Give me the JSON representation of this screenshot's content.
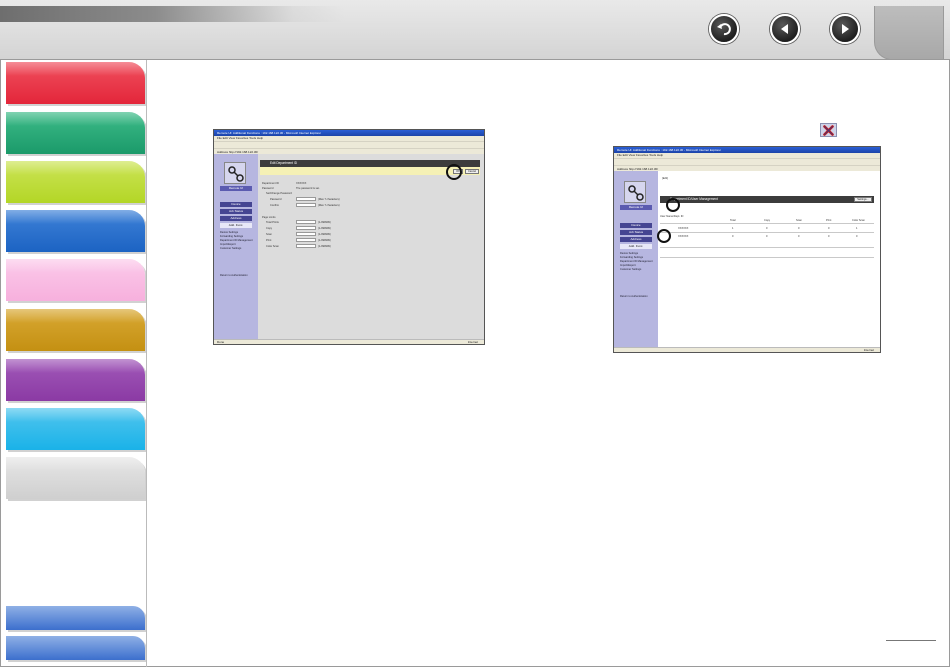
{
  "colors": {
    "tab_red": "#e3263a",
    "tab_green": "#1b9a6a",
    "tab_lime": "#b3d626",
    "tab_blue": "#1c63c3",
    "tab_pink": "#f7b0dd",
    "tab_gold": "#c49012",
    "tab_purple": "#8b3aa4",
    "tab_cyan": "#1ab2e8",
    "tab_gray": "#d4d4d4"
  },
  "header": {
    "icons": [
      "back-icon",
      "previous-page-icon",
      "next-page-icon"
    ]
  },
  "left_shot": {
    "window_title": "Remote UI: Additional Functions : 192.168.122.30 - Microsoft Internet Explorer",
    "menu": "File  Edit  View  Favorites  Tools  Help",
    "address": "Address  http://192.168.122.30/",
    "pane_title": "Edit Department ID",
    "ok_label": "OK",
    "cancel_label": "Cancel",
    "sidebar": {
      "logo_caption": "Remote UI",
      "pills": [
        "Device",
        "Job Status",
        "Address",
        "Add. Func."
      ],
      "links": [
        "Device Settings",
        "Forwarding Settings",
        "Department ID Management",
        "Import/Export",
        "Customer Settings"
      ],
      "bottom_link": "Return to Authentication"
    },
    "fields": {
      "department_id_label": "Department ID",
      "department_id_value": "XXXXXX",
      "password_label": "Password",
      "password_value": "The password is set.",
      "change_password_label": "Set/Change Password",
      "new_password_label": "Password",
      "confirm_label": "Confirm",
      "max_chars": "(Max 7 characters)",
      "page_limits_label": "Page Limits",
      "limits": [
        "Total Prints",
        "Copy",
        "Scan",
        "Print",
        "Color Scan"
      ],
      "limit_range": "(1-999999)"
    },
    "status": "Done",
    "status_zone": "Internet"
  },
  "right_shot": {
    "window_title": "Remote UI: Additional Functions : 192.168.122.30 - Microsoft Internet Explorer",
    "menu": "File  Edit  View  Favorites  Tools  Help",
    "address": "Address  http://192.168.122.30/",
    "tab_label": "[Edit]",
    "pane_title": "Department ID/User Management",
    "settings_label": "Settings...",
    "columns": [
      "User Name/Dept. ID",
      "Total",
      "Copy",
      "Scan",
      "Print",
      "Color Scan"
    ],
    "rows": [
      {
        "id": "XXXXXX",
        "values": [
          "1",
          "0",
          "0",
          "0",
          "1"
        ]
      },
      {
        "id": "XXXXXX",
        "values": [
          "0",
          "0",
          "0",
          "0",
          "0"
        ]
      }
    ],
    "sidebar": {
      "logo_caption": "Remote UI",
      "pills": [
        "Device",
        "Job Status",
        "Address",
        "Add. Func."
      ],
      "links": [
        "Device Settings",
        "Forwarding Settings",
        "Department ID Management",
        "Import/Export",
        "Customer Settings"
      ],
      "bottom_link": "Return to Authentication"
    },
    "status_zone": "Internet"
  },
  "delete_icon": "close-icon"
}
